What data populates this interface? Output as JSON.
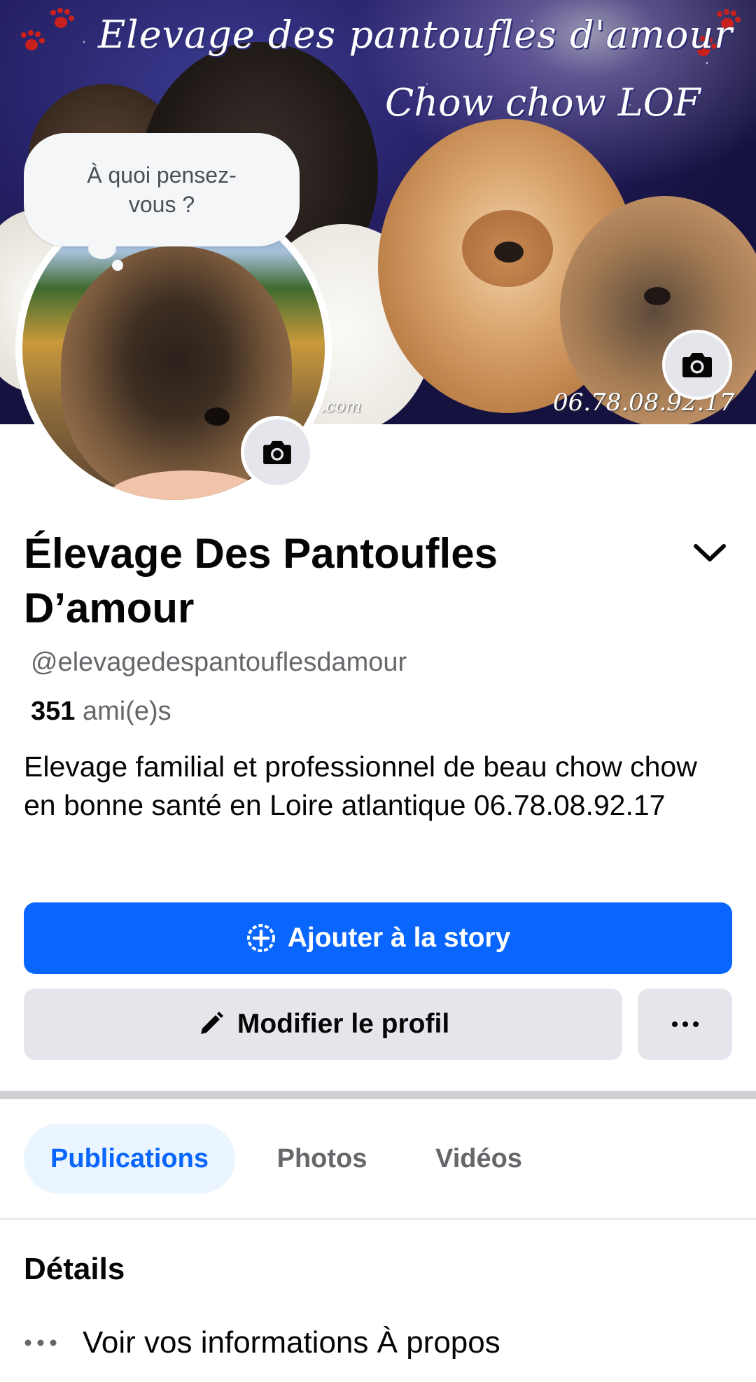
{
  "cover": {
    "title": "Elevage des pantoufles d'amour",
    "subtitle": "Chow chow LOF",
    "phone": "06.78.08.92.17",
    "watermark": ".com"
  },
  "thought_bubble": {
    "text": "À quoi pensez-vous ?"
  },
  "profile": {
    "name": "Élevage Des Pantoufles D’amour",
    "username": "@elevagedespantouflesdamour",
    "friends_count": "351",
    "friends_label": "ami(e)s",
    "bio": "Elevage familial et professionnel de beau chow chow en bonne santé en Loire atlantique 06.78.08.92.17"
  },
  "buttons": {
    "add_story": "Ajouter à la story",
    "edit_profile": "Modifier le profil"
  },
  "tabs": [
    {
      "label": "Publications",
      "active": true
    },
    {
      "label": "Photos",
      "active": false
    },
    {
      "label": "Vidéos",
      "active": false
    }
  ],
  "details": {
    "title": "Détails",
    "about_link": "Voir vos informations À propos"
  },
  "colors": {
    "primary": "#0866ff",
    "secondary_button": "#e4e6eb",
    "active_tab_bg": "#ebf5ff",
    "text_primary": "#050505",
    "text_secondary": "#65676b",
    "paw_accent": "#c9201d"
  },
  "icons": {
    "cover_camera": "camera-icon",
    "avatar_camera": "camera-icon",
    "expand": "chevron-down-icon",
    "story": "plus-circle-icon",
    "edit": "pencil-icon",
    "more": "more-dots-icon",
    "about": "more-dots-icon"
  }
}
